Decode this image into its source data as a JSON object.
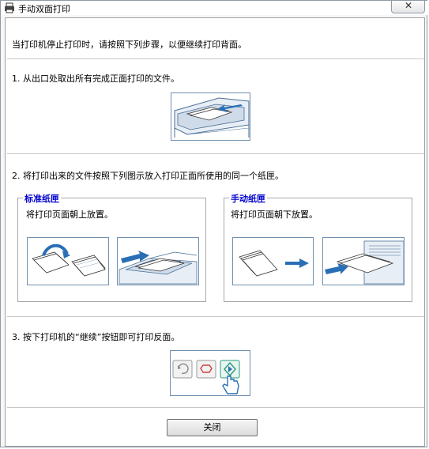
{
  "window": {
    "title": "手动双面打印",
    "close_glyph": "✕"
  },
  "intro": "当打印机停止打印时，请按照下列步骤，以便继续打印背面。",
  "steps": {
    "step1": "1. 从出口处取出所有完成正面打印的文件。",
    "step2": "2. 将打印出来的文件按照下列图示放入打印正面所使用的同一个纸匣。",
    "step3": "3. 按下打印机的“继续”按钮即可打印反面。"
  },
  "trays": {
    "standard": {
      "title": "标准纸匣",
      "desc": "将打印页面朝上放置。"
    },
    "manual": {
      "title": "手动纸匣",
      "desc": "将打印页面朝下放置。"
    }
  },
  "buttons": {
    "close": "关闭"
  },
  "colors": {
    "accent": "#0000cc",
    "illustration_blue": "#2a6fb5"
  },
  "icons": [
    "printer-icon",
    "close-icon",
    "cancel-icon",
    "stop-icon",
    "continue-icon",
    "hand-pointer-icon"
  ]
}
